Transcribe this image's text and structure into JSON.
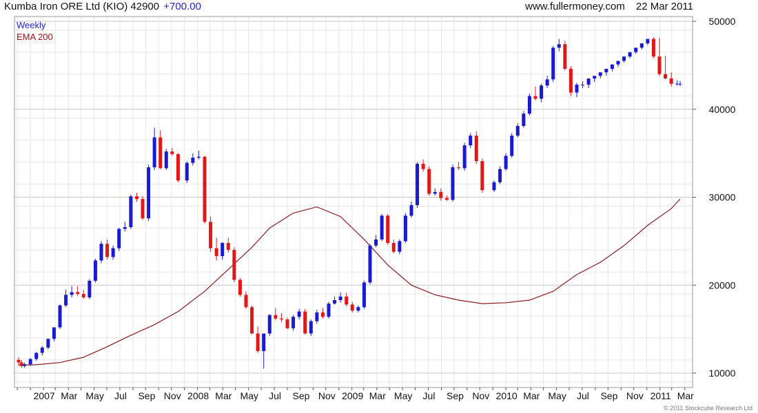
{
  "header": {
    "title": "Kumba Iron ORE Ltd (KIO) 42900",
    "change": "+700.00",
    "site": "www.fullermoney.com",
    "date": "22 Mar 2011"
  },
  "legend": {
    "line1": "Weekly",
    "line2": "EMA 200"
  },
  "footer": {
    "copyright": "© 2011 Stockcube Research Ltd"
  },
  "colors": {
    "up": "#1a1ad0",
    "down": "#e01818",
    "ema": "#8b1a1a",
    "grid": "#e6e6e6",
    "grid_major": "#c4c4c4"
  },
  "chart_data": {
    "type": "candlestick",
    "title": "Kumba Iron ORE Ltd (KIO) 42900",
    "interval": "Weekly",
    "ylim": [
      9000,
      50500
    ],
    "y_ticks": [
      10000,
      20000,
      30000,
      40000,
      50000
    ],
    "y_tick_labels": [
      "10000",
      "20000",
      "30000",
      "40000",
      "50000"
    ],
    "x_tick_labels": [
      "2007",
      "Mar",
      "May",
      "Jul",
      "Sep",
      "Nov",
      "2008",
      "Mar",
      "May",
      "Jul",
      "Sep",
      "Nov",
      "2009",
      "Mar",
      "May",
      "Jul",
      "Sep",
      "Nov",
      "2010",
      "Mar",
      "May",
      "Jul",
      "Sep",
      "Nov",
      "2011",
      "Mar"
    ],
    "grid": true,
    "y_axis_side": "right",
    "series": [
      {
        "name": "Weekly",
        "kind": "ohlc",
        "x": [
          "2006-12-04",
          "2006-12-11",
          "2006-12-18",
          "2007-01-01",
          "2007-01-15",
          "2007-01-29",
          "2007-02-12",
          "2007-02-26",
          "2007-03-12",
          "2007-03-26",
          "2007-04-09",
          "2007-04-23",
          "2007-05-07",
          "2007-05-21",
          "2007-06-04",
          "2007-06-18",
          "2007-07-02",
          "2007-07-16",
          "2007-07-30",
          "2007-08-13",
          "2007-08-27",
          "2007-09-10",
          "2007-09-24",
          "2007-10-08",
          "2007-10-22",
          "2007-11-05",
          "2007-11-19",
          "2007-12-03",
          "2007-12-17",
          "2008-01-07",
          "2008-01-21",
          "2008-02-04",
          "2008-02-18",
          "2008-03-03",
          "2008-03-17",
          "2008-03-31",
          "2008-04-14",
          "2008-04-28",
          "2008-05-12",
          "2008-05-26",
          "2008-06-09",
          "2008-06-23",
          "2008-07-07",
          "2008-07-21",
          "2008-08-04",
          "2008-08-18",
          "2008-09-01",
          "2008-09-15",
          "2008-09-29",
          "2008-10-13",
          "2008-10-27",
          "2008-11-10",
          "2008-11-24",
          "2008-12-08",
          "2008-12-22",
          "2009-01-05",
          "2009-01-19",
          "2009-02-02",
          "2009-02-16",
          "2009-03-02",
          "2009-03-16",
          "2009-03-30",
          "2009-04-13",
          "2009-04-27",
          "2009-05-11",
          "2009-05-25",
          "2009-06-08",
          "2009-06-22",
          "2009-07-06",
          "2009-07-20",
          "2009-08-03",
          "2009-08-17",
          "2009-08-31",
          "2009-09-14",
          "2009-09-28",
          "2009-10-12",
          "2009-10-26",
          "2009-11-09",
          "2009-11-23",
          "2009-12-07",
          "2010-01-04",
          "2010-01-18",
          "2010-02-01",
          "2010-02-15",
          "2010-03-01",
          "2010-03-15",
          "2010-03-29",
          "2010-04-12",
          "2010-04-26",
          "2010-05-10",
          "2010-05-24",
          "2010-06-07",
          "2010-06-21",
          "2010-07-05",
          "2010-07-19",
          "2010-08-02",
          "2010-08-16",
          "2010-08-30",
          "2010-09-13",
          "2010-09-27",
          "2010-10-11",
          "2010-10-25",
          "2010-11-08",
          "2010-11-22",
          "2010-12-06",
          "2010-12-20",
          "2011-01-03",
          "2011-01-17",
          "2011-01-31",
          "2011-02-14",
          "2011-02-28",
          "2011-03-14",
          "2011-03-21"
        ],
        "open": [
          11500,
          11200,
          10800,
          11000,
          11600,
          12300,
          12900,
          13900,
          15200,
          17700,
          18900,
          19200,
          19000,
          18600,
          20500,
          22800,
          24700,
          23200,
          24200,
          26400,
          26600,
          30100,
          29800,
          27600,
          33400,
          36800,
          33300,
          35200,
          34900,
          31900,
          33900,
          34500,
          34600,
          27200,
          24200,
          23300,
          24800,
          24000,
          20600,
          18900,
          17500,
          14500,
          12500,
          14500,
          16600,
          16200,
          16100,
          15100,
          16400,
          17000,
          14500,
          15900,
          16900,
          16400,
          17900,
          18300,
          18700,
          17800,
          17100,
          17500,
          20300,
          24500,
          25200,
          27900,
          24800,
          23800,
          25000,
          27900,
          29100,
          33800,
          33200,
          30400,
          30600,
          29900,
          29700,
          33400,
          33300,
          35900,
          37000,
          34100,
          30800,
          31700,
          33200,
          34700,
          37000,
          38100,
          39500,
          41500,
          41200,
          42700,
          43400,
          47000,
          47400,
          44600,
          41900,
          42800,
          42800,
          43500,
          43800,
          44200,
          44600,
          45100,
          45500,
          46000,
          46500,
          47000,
          47500,
          48000,
          46000,
          44000,
          43500,
          42900,
          42900
        ],
        "high": [
          11800,
          11500,
          11200,
          11700,
          12400,
          13100,
          13900,
          15200,
          17800,
          19500,
          19900,
          19900,
          19500,
          20700,
          23000,
          25000,
          25200,
          24500,
          26500,
          27200,
          30300,
          30500,
          30100,
          33700,
          37900,
          37600,
          35500,
          35600,
          35000,
          34100,
          35000,
          35300,
          34700,
          27800,
          25400,
          24900,
          25400,
          24300,
          20800,
          19300,
          17700,
          15300,
          14500,
          16700,
          17400,
          16800,
          16300,
          16600,
          17300,
          17300,
          16100,
          17200,
          17400,
          18100,
          18700,
          19200,
          19100,
          18100,
          17700,
          20500,
          24700,
          25700,
          28100,
          28100,
          25200,
          25200,
          28200,
          29500,
          34000,
          34300,
          33500,
          31000,
          31000,
          30200,
          33700,
          34000,
          36200,
          37300,
          37500,
          34400,
          31900,
          33500,
          35000,
          37300,
          38400,
          39800,
          41800,
          42600,
          42900,
          43800,
          47200,
          48000,
          47800,
          44900,
          43000,
          43200,
          43000,
          43700,
          44100,
          44400,
          44800,
          45300,
          45700,
          46200,
          46700,
          47300,
          47700,
          48200,
          48100,
          46100,
          44200,
          43300,
          43200
        ],
        "low": [
          10900,
          10600,
          10600,
          10800,
          11400,
          12000,
          12700,
          13600,
          15000,
          17500,
          18600,
          18800,
          18400,
          18400,
          20300,
          22500,
          22900,
          22900,
          23900,
          26100,
          26400,
          29500,
          27400,
          27300,
          33100,
          33200,
          33100,
          34700,
          31700,
          31600,
          33600,
          34300,
          27000,
          23800,
          22800,
          22900,
          23700,
          20300,
          18700,
          17300,
          14400,
          12300,
          10500,
          14200,
          16000,
          15800,
          15000,
          14800,
          16100,
          14400,
          14200,
          15600,
          16200,
          16200,
          17800,
          18000,
          17600,
          16900,
          16900,
          17300,
          20100,
          24300,
          25000,
          24600,
          23600,
          23500,
          24800,
          27700,
          28800,
          32900,
          30200,
          30200,
          29600,
          29600,
          29500,
          33100,
          33000,
          35600,
          33800,
          30500,
          30600,
          31500,
          33000,
          34500,
          36800,
          37900,
          39300,
          41000,
          40800,
          42400,
          43100,
          46600,
          44400,
          41500,
          41400,
          42400,
          42400,
          43100,
          43500,
          43800,
          44300,
          44800,
          45300,
          45800,
          46300,
          46800,
          47300,
          45800,
          43800,
          43400,
          42600,
          42700,
          42600
        ],
        "close": [
          11200,
          10800,
          11000,
          11600,
          12300,
          12900,
          13900,
          15200,
          17700,
          18900,
          19200,
          19000,
          18600,
          20500,
          22800,
          24700,
          23200,
          24200,
          26400,
          26600,
          30100,
          29800,
          27600,
          33400,
          36800,
          33300,
          35200,
          34900,
          31900,
          33900,
          34500,
          34600,
          27200,
          24200,
          23300,
          24800,
          24000,
          20600,
          18900,
          17500,
          14500,
          12500,
          14500,
          16600,
          16200,
          16100,
          15100,
          16400,
          17000,
          14500,
          15900,
          16900,
          16400,
          17900,
          18300,
          18700,
          17800,
          17100,
          17500,
          20300,
          24500,
          25200,
          27900,
          24800,
          23800,
          25000,
          27900,
          29100,
          33800,
          33200,
          30400,
          30600,
          29900,
          29700,
          33400,
          33300,
          35900,
          37000,
          34100,
          30800,
          31700,
          33200,
          34700,
          37000,
          38100,
          39500,
          41500,
          41200,
          42700,
          43400,
          47000,
          47400,
          44600,
          41900,
          42800,
          42800,
          43500,
          43800,
          44200,
          44600,
          45100,
          45500,
          46000,
          46500,
          47000,
          47500,
          48000,
          46000,
          44000,
          43500,
          42900,
          42900,
          42900
        ]
      },
      {
        "name": "EMA 200",
        "kind": "line",
        "x": [
          "2006-12-04",
          "2007-01-15",
          "2007-03-12",
          "2007-05-07",
          "2007-07-02",
          "2007-08-27",
          "2007-10-22",
          "2007-12-17",
          "2008-02-18",
          "2008-04-14",
          "2008-06-09",
          "2008-07-21",
          "2008-09-15",
          "2008-11-10",
          "2009-01-05",
          "2009-03-02",
          "2009-04-27",
          "2009-06-22",
          "2009-08-17",
          "2009-10-12",
          "2009-12-07",
          "2010-02-01",
          "2010-03-29",
          "2010-05-24",
          "2010-07-19",
          "2010-09-13",
          "2010-11-08",
          "2011-01-03",
          "2011-02-28",
          "2011-03-21"
        ],
        "y": [
          10900,
          10950,
          11200,
          11800,
          13000,
          14300,
          15500,
          17000,
          19300,
          21800,
          24300,
          26500,
          28200,
          28900,
          27800,
          25200,
          22300,
          20000,
          18900,
          18300,
          17900,
          18000,
          18300,
          19300,
          21200,
          22600,
          24500,
          26800,
          28700,
          29800
        ]
      }
    ]
  }
}
